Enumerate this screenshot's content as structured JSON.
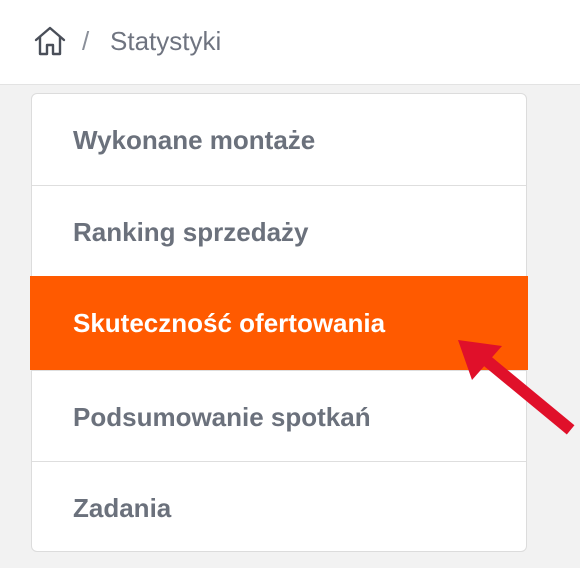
{
  "breadcrumb": {
    "home_icon": "home-icon",
    "separator": "/",
    "current": "Statystyki"
  },
  "menu": {
    "items": [
      {
        "label": "Wykonane montaże",
        "active": false
      },
      {
        "label": "Ranking sprzedaży",
        "active": false
      },
      {
        "label": "Skuteczność ofertowania",
        "active": true
      },
      {
        "label": "Podsumowanie spotkań",
        "active": false
      },
      {
        "label": "Zadania",
        "active": false
      }
    ]
  },
  "annotation": {
    "arrow_icon": "red-pointer-arrow-icon"
  },
  "colors": {
    "active_bg": "#ff5a00",
    "active_text": "#ffffff",
    "item_text": "#6b717c",
    "arrow": "#e0102a"
  }
}
